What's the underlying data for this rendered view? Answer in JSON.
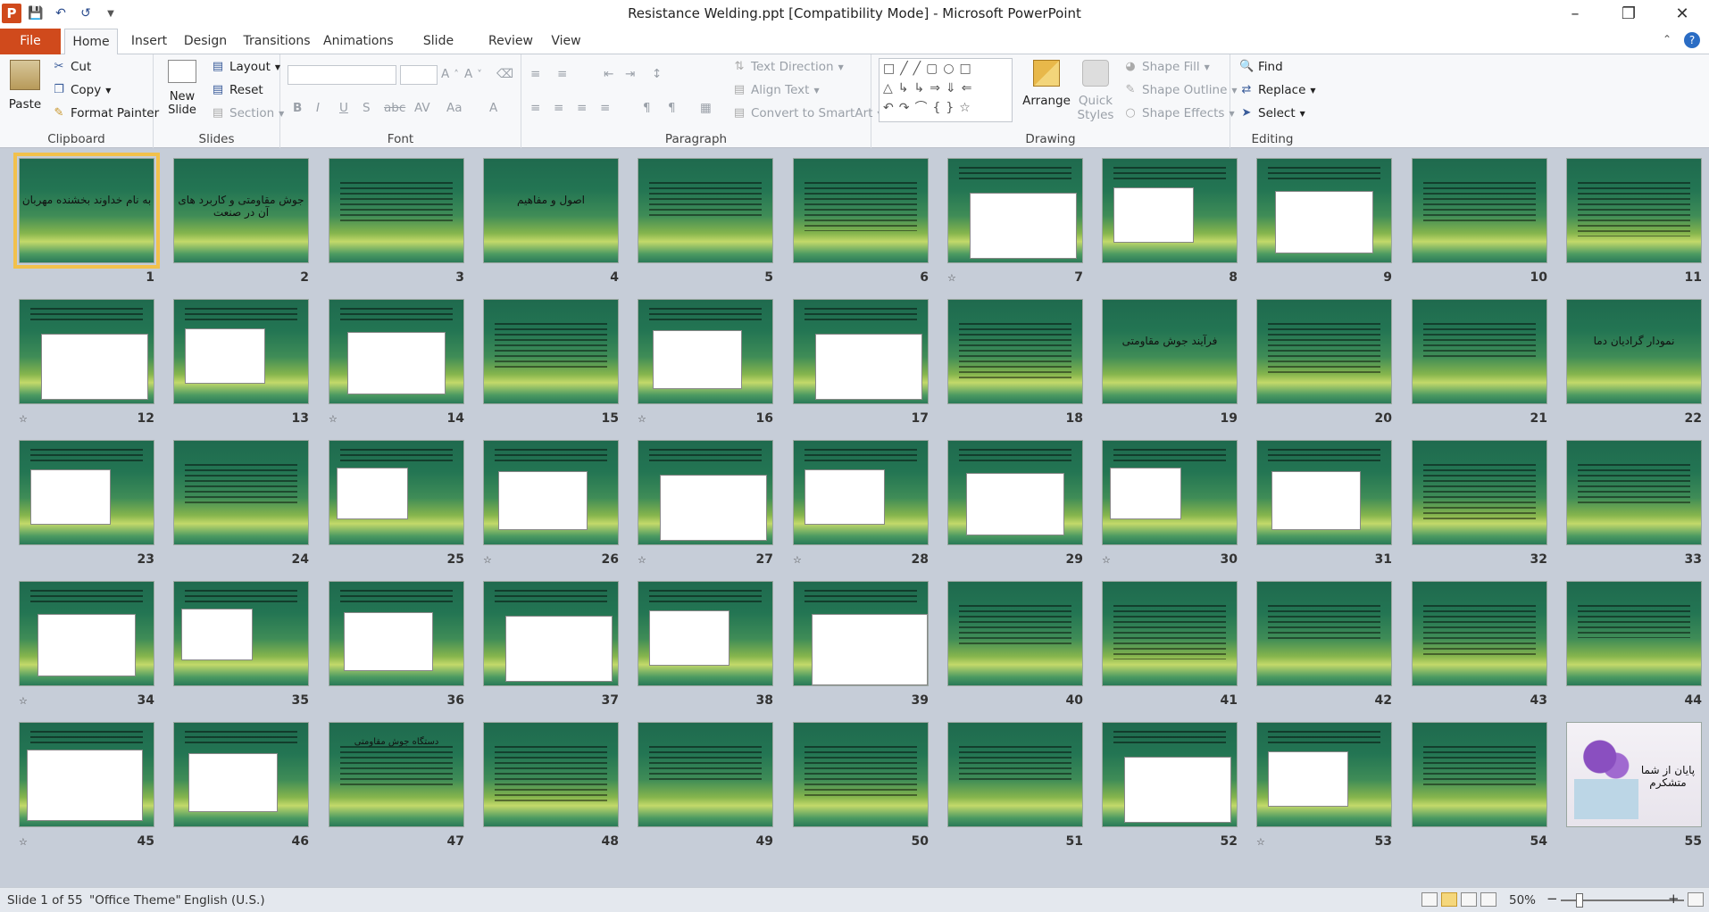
{
  "app": {
    "title": "Resistance Welding.ppt [Compatibility Mode]  -  Microsoft PowerPoint",
    "icon_letter": "P"
  },
  "qat": {
    "icons": [
      "save-icon",
      "undo-icon",
      "redo-icon",
      "customize-icon"
    ]
  },
  "tabs": [
    "File",
    "Home",
    "Insert",
    "Design",
    "Transitions",
    "Animations",
    "Slide Show",
    "Review",
    "View"
  ],
  "ribbon": {
    "clipboard": {
      "label": "Clipboard",
      "paste": "Paste",
      "cut": "Cut",
      "copy": "Copy",
      "format_painter": "Format Painter"
    },
    "slides": {
      "label": "Slides",
      "new_slide": "New Slide",
      "layout": "Layout",
      "reset": "Reset",
      "section": "Section"
    },
    "font": {
      "label": "Font"
    },
    "paragraph": {
      "label": "Paragraph",
      "text_direction": "Text Direction",
      "align_text": "Align Text",
      "convert_smartart": "Convert to SmartArt"
    },
    "drawing": {
      "label": "Drawing",
      "arrange": "Arrange",
      "quick_styles": "Quick Styles",
      "shape_fill": "Shape Fill",
      "shape_outline": "Shape Outline",
      "shape_effects": "Shape Effects"
    },
    "editing": {
      "label": "Editing",
      "find": "Find",
      "replace": "Replace",
      "select": "Select"
    }
  },
  "slides": [
    {
      "n": 1,
      "kind": "title",
      "text": "به نام خداوند بخشنده مهربان",
      "selected": true
    },
    {
      "n": 2,
      "kind": "title",
      "text": "جوش مقاومتی و کاربرد های آن در صنعت"
    },
    {
      "n": 3,
      "kind": "text"
    },
    {
      "n": 4,
      "kind": "title",
      "text": "اصول و مفاهیم"
    },
    {
      "n": 5,
      "kind": "text"
    },
    {
      "n": 6,
      "kind": "text"
    },
    {
      "n": 7,
      "kind": "diagram",
      "star": true
    },
    {
      "n": 8,
      "kind": "image"
    },
    {
      "n": 9,
      "kind": "image"
    },
    {
      "n": 10,
      "kind": "text"
    },
    {
      "n": 11,
      "kind": "text"
    },
    {
      "n": 12,
      "kind": "image",
      "star": true
    },
    {
      "n": 13,
      "kind": "image"
    },
    {
      "n": 14,
      "kind": "image",
      "star": true
    },
    {
      "n": 15,
      "kind": "text"
    },
    {
      "n": 16,
      "kind": "image",
      "star": true
    },
    {
      "n": 17,
      "kind": "image"
    },
    {
      "n": 18,
      "kind": "text"
    },
    {
      "n": 19,
      "kind": "title",
      "text": "فرآیند جوش مقاومتی"
    },
    {
      "n": 20,
      "kind": "text"
    },
    {
      "n": 21,
      "kind": "text"
    },
    {
      "n": 22,
      "kind": "title",
      "text": "نمودار گرادیان دما"
    },
    {
      "n": 23,
      "kind": "image"
    },
    {
      "n": 24,
      "kind": "text"
    },
    {
      "n": 25,
      "kind": "image"
    },
    {
      "n": 26,
      "kind": "image",
      "star": true
    },
    {
      "n": 27,
      "kind": "image",
      "star": true
    },
    {
      "n": 28,
      "kind": "image",
      "star": true
    },
    {
      "n": 29,
      "kind": "image"
    },
    {
      "n": 30,
      "kind": "image",
      "star": true
    },
    {
      "n": 31,
      "kind": "image"
    },
    {
      "n": 32,
      "kind": "text"
    },
    {
      "n": 33,
      "kind": "text"
    },
    {
      "n": 34,
      "kind": "image",
      "star": true
    },
    {
      "n": 35,
      "kind": "image"
    },
    {
      "n": 36,
      "kind": "image"
    },
    {
      "n": 37,
      "kind": "image"
    },
    {
      "n": 38,
      "kind": "image"
    },
    {
      "n": 39,
      "kind": "table"
    },
    {
      "n": 40,
      "kind": "text"
    },
    {
      "n": 41,
      "kind": "text"
    },
    {
      "n": 42,
      "kind": "text"
    },
    {
      "n": 43,
      "kind": "text"
    },
    {
      "n": 44,
      "kind": "text"
    },
    {
      "n": 45,
      "kind": "table",
      "star": true
    },
    {
      "n": 46,
      "kind": "image"
    },
    {
      "n": 47,
      "kind": "text",
      "text": "دستگاه جوش مقاومتی"
    },
    {
      "n": 48,
      "kind": "text"
    },
    {
      "n": 49,
      "kind": "text"
    },
    {
      "n": 50,
      "kind": "text"
    },
    {
      "n": 51,
      "kind": "text"
    },
    {
      "n": 52,
      "kind": "image"
    },
    {
      "n": 53,
      "kind": "image",
      "star": true
    },
    {
      "n": 54,
      "kind": "text"
    },
    {
      "n": 55,
      "kind": "photo",
      "text": "پایان از شما متشکرم"
    }
  ],
  "status": {
    "slide_count": "Slide 1 of 55",
    "theme": "\"Office Theme\"",
    "language": "English (U.S.)",
    "zoom": "50%"
  }
}
